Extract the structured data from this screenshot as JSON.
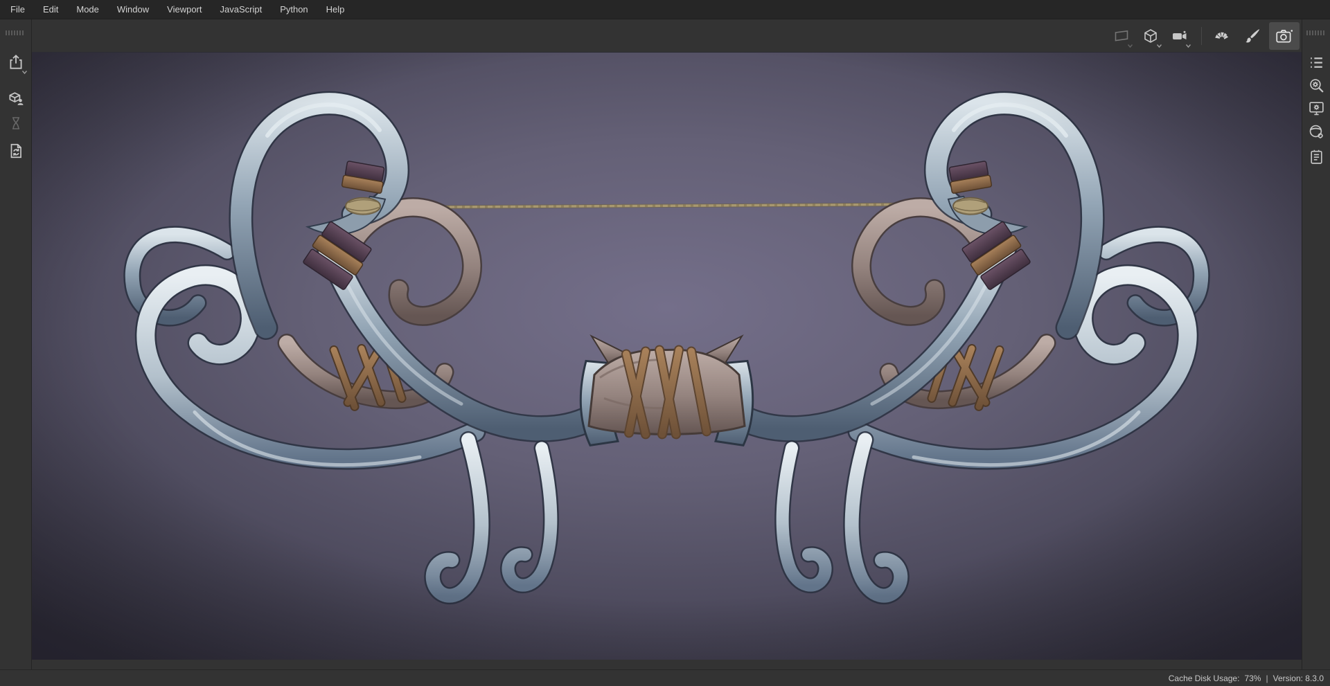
{
  "menu_bar": {
    "items": [
      "File",
      "Edit",
      "Mode",
      "Window",
      "Viewport",
      "JavaScript",
      "Python",
      "Help"
    ]
  },
  "top_toolbar": {
    "view_icons": [
      {
        "name": "camera-projection",
        "dropdown": true,
        "state": "disabled"
      },
      {
        "name": "mesh-display",
        "dropdown": true,
        "state": "normal"
      },
      {
        "name": "camera-selector",
        "dropdown": true,
        "state": "normal"
      }
    ],
    "mode_icons": [
      {
        "name": "baking-mode",
        "state": "normal"
      },
      {
        "name": "painting-mode",
        "state": "normal"
      },
      {
        "name": "rendering-mode",
        "state": "selected"
      }
    ]
  },
  "left_toolbar": {
    "icons": [
      {
        "name": "export-textures",
        "dropdown": true,
        "state": "normal"
      },
      {
        "name": "publish-asset",
        "state": "normal"
      },
      {
        "name": "pending-operations-hourglass",
        "state": "disabled"
      },
      {
        "name": "reload-resources",
        "state": "normal"
      }
    ]
  },
  "right_dock": {
    "icons": [
      {
        "name": "renderer-settings"
      },
      {
        "name": "viewer-settings"
      },
      {
        "name": "display-settings"
      },
      {
        "name": "shader-settings"
      },
      {
        "name": "log"
      }
    ]
  },
  "status_bar": {
    "cache_label": "Cache Disk Usage:",
    "cache_value": "73%",
    "separator": "|",
    "version": "Version: 8.3.0"
  },
  "viewport": {
    "model": "ornate curved fantasy bow with string",
    "colors": {
      "background_center": "#716d84",
      "background_edge": "#34323f",
      "steel": "#9fb0bf",
      "horn": "#9b8a84",
      "leather_wrap": "#553f52",
      "strap": "#926f4c",
      "rope": "#a8986f"
    }
  }
}
